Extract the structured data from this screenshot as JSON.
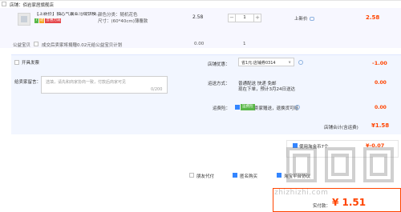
{
  "store": {
    "label": "店铺：佰岩家居旗舰店"
  },
  "item": {
    "title": "【上新价】抽芯气囊亚马绒饼模...",
    "badges": [
      "7",
      "退",
      "普惠力减"
    ],
    "spec_color": "颜色分类：随机花色",
    "spec_size": "尺寸：(60*40cm)薄覆款",
    "unit_price": "2.58",
    "quantity": "1",
    "minus": "−",
    "plus": "+",
    "old_price_label": "上新价",
    "subtotal": "2.58"
  },
  "charity": {
    "label": "公益宝贝",
    "text": "成交后卖家将捐赠0.02元给公益宝贝计划",
    "amount": "0.00",
    "qty": "1"
  },
  "invoice": {
    "label": "开具发票"
  },
  "message": {
    "label": "给卖家留言：",
    "placeholder": "选填，请先和商家协商一致，付款后商家可见",
    "count": "0/200"
  },
  "coupon": {
    "label": "店铺优惠：",
    "selected": "省1元:店铺券0314",
    "arrow": "∨",
    "amount": "-1.00"
  },
  "shipping": {
    "label": "运送方式：",
    "line1": "普通配送 快递 免邮",
    "line2": "现在下单，预计3月24日送达",
    "amount": "0.00"
  },
  "insurance": {
    "label": "运费险：",
    "tag": "运费险",
    "text": "卖家赠送，退换货可赔",
    "amount": "0.00"
  },
  "store_total": {
    "label": "店铺合计(含运费)",
    "amount": "¥1.58"
  },
  "tmall": {
    "label": "使用淘金币7个",
    "amount": "¥-0.07"
  },
  "options": [
    {
      "label": "朋友代付",
      "checked": false
    },
    {
      "label": "匿名购买",
      "checked": true
    },
    {
      "label": "淘宝平台协议",
      "checked": true
    }
  ],
  "pay": {
    "label": "实付款：",
    "amount": "¥ 1.51"
  },
  "watermark": {
    "text": "zhizhizhi.com"
  },
  "colors": {
    "accent": "#ff4400",
    "primary": "#3385ff",
    "green": "#5ab849"
  }
}
